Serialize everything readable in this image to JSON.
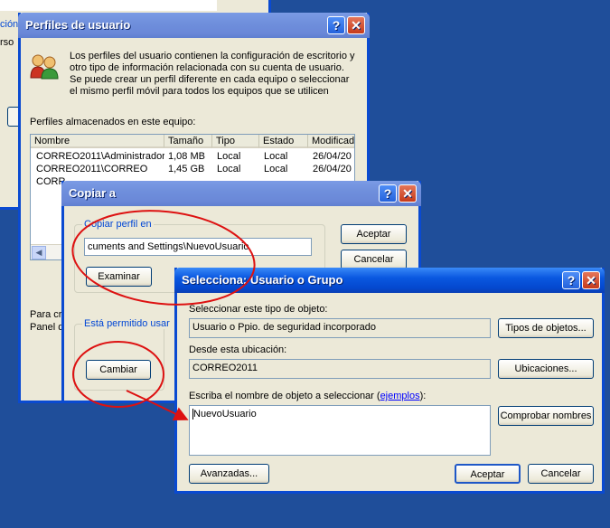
{
  "bg_window": {
    "text_a": "ción",
    "text_b": "rso"
  },
  "profiles": {
    "title": "Perfiles de usuario",
    "intro": "Los perfiles del usuario contienen la configuración de escritorio y otro tipo de información relacionada con su cuenta de usuario. Se puede crear un perfil diferente en cada equipo o seleccionar el mismo perfil móvil para todos los equipos que se utilicen",
    "stored_label": "Perfiles almacenados en este equipo:",
    "columns": [
      "Nombre",
      "Tamaño",
      "Tipo",
      "Estado",
      "Modificado"
    ],
    "rows": [
      [
        "CORREO2011\\Administrador",
        "1,08 MB",
        "Local",
        "Local",
        "26/04/20"
      ],
      [
        "CORREO2011\\CORREO",
        "1,45 GB",
        "Local",
        "Local",
        "26/04/20"
      ],
      [
        "CORR",
        "",
        "",
        "",
        ""
      ]
    ],
    "bottom_text_1": "Para cr",
    "bottom_text_2": "Panel d"
  },
  "copy_to": {
    "title": "Copiar a",
    "group_label": "Copiar perfil en",
    "path_value": "cuments and Settings\\NuevoUsuario",
    "browse_label": "Examinar",
    "allowed_label": "Está permitido usar",
    "change_label": "Cambiar",
    "ok_label": "Aceptar",
    "cancel_label": "Cancelar"
  },
  "select_user": {
    "title": "Selecciona: Usuario o Grupo",
    "type_label": "Seleccionar este tipo de objeto:",
    "type_value": "Usuario o Ppio. de seguridad incorporado",
    "types_button": "Tipos de objetos...",
    "location_label": "Desde esta ubicación:",
    "location_value": "CORREO2011",
    "locations_button": "Ubicaciones...",
    "name_label_pre": "Escriba el nombre de objeto a seleccionar (",
    "name_label_link": "ejemplos",
    "name_label_post": "):",
    "name_value": "NuevoUsuario",
    "check_button": "Comprobar nombres",
    "advanced_button": "Avanzadas...",
    "ok_button": "Aceptar",
    "cancel_button": "Cancelar"
  },
  "colors": {
    "annotation_red": "#dd1111",
    "xp_blue": "#0a4ad1",
    "desktop": "#1f4e9a"
  }
}
